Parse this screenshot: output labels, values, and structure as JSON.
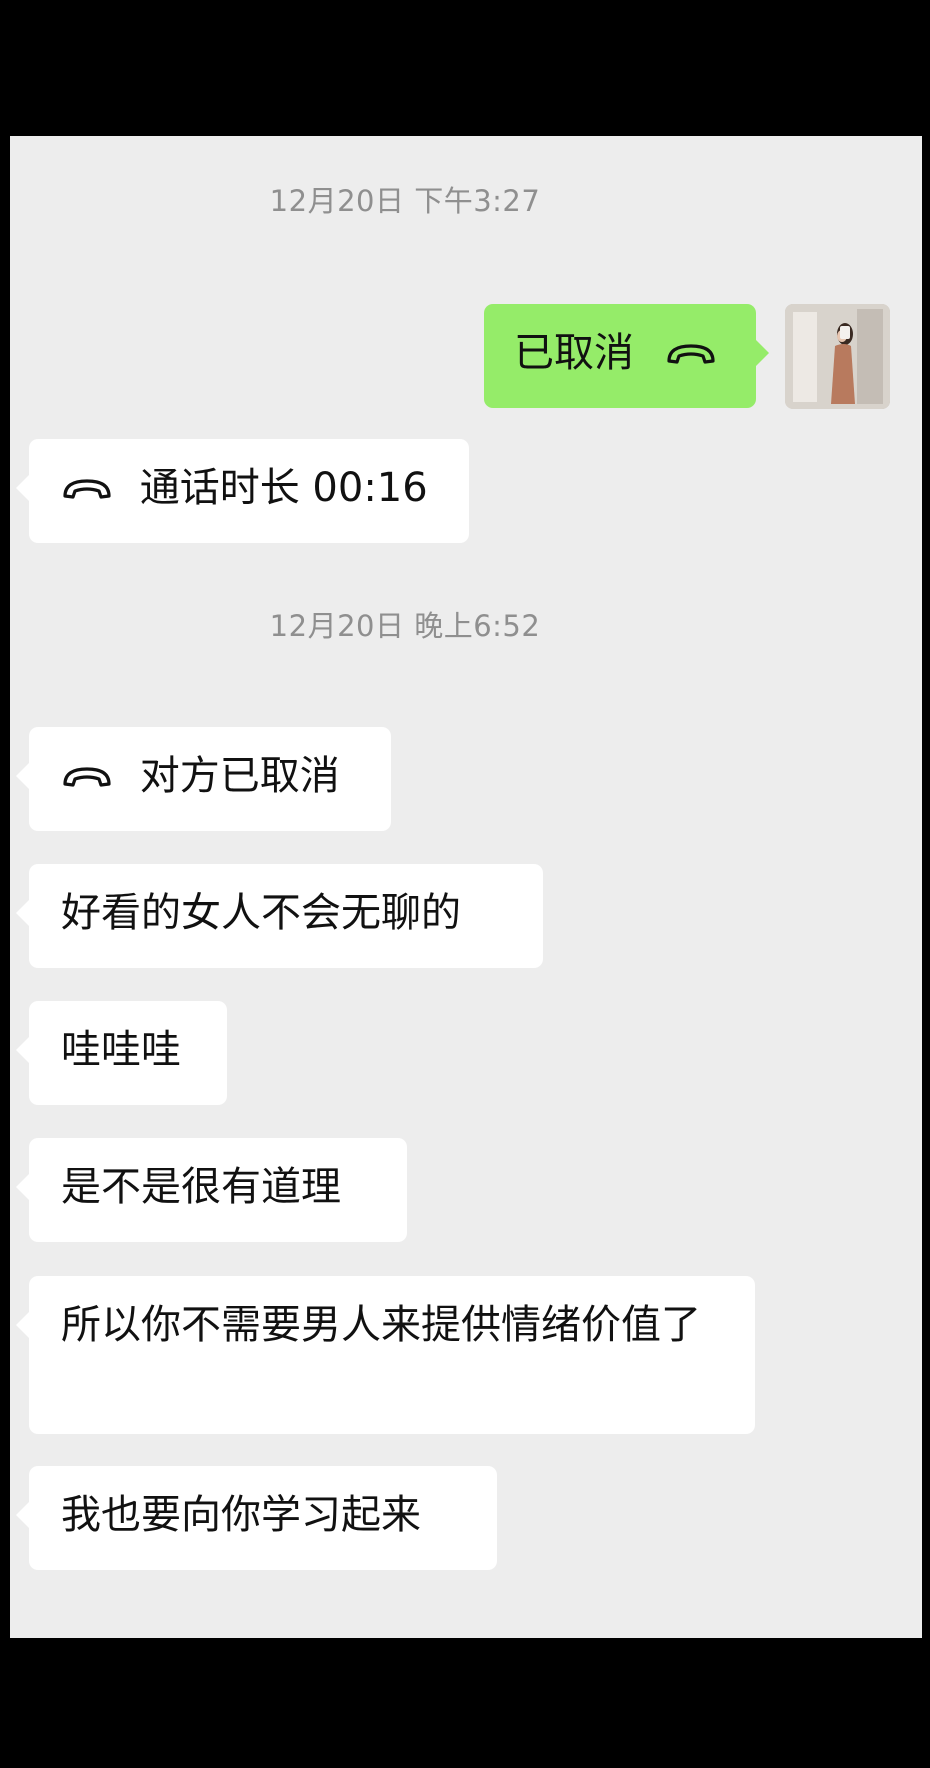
{
  "chat": {
    "timestamps": [
      "12月20日 下午3:27",
      "12月20日 晚上6:52"
    ],
    "self_call": {
      "label": "已取消",
      "icon": "phone-hangup-icon"
    },
    "duration_call": {
      "label": "通话时长 00:16",
      "icon": "phone-hangup-icon"
    },
    "other_call": {
      "label": "对方已取消",
      "icon": "phone-hangup-icon"
    },
    "messages": [
      "好看的女人不会无聊的",
      "哇哇哇",
      "是不是很有道理",
      "所以你不需要男人来提供情绪价值了",
      "我也要向你学习起来"
    ],
    "colors": {
      "self_bubble": "#95ec69",
      "other_bubble": "#ffffff",
      "background": "#ededed"
    }
  }
}
